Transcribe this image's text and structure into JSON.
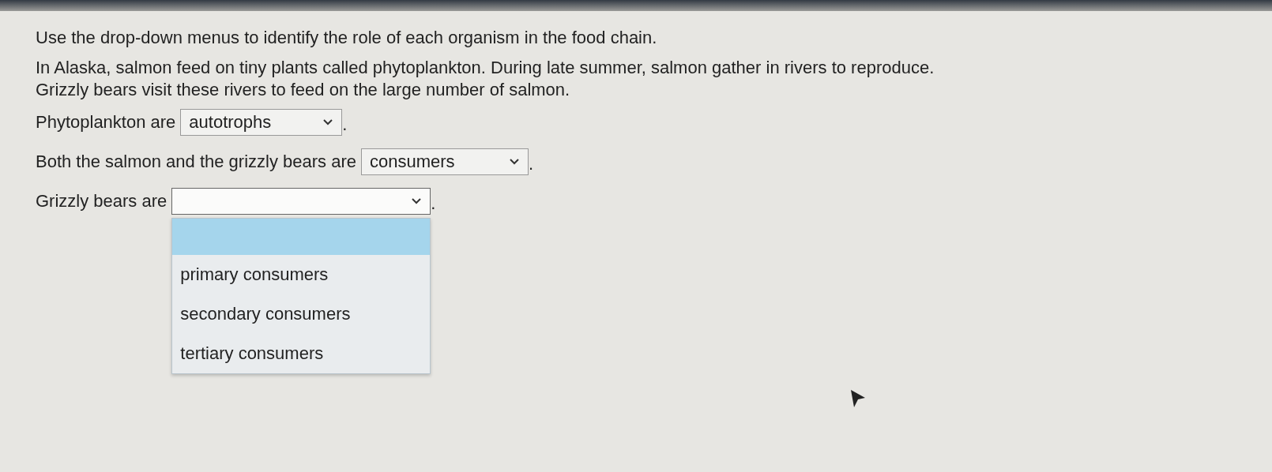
{
  "instructions": "Use the drop-down menus to identify the role of each organism in the food chain.",
  "passage_lines": [
    "In Alaska, salmon feed on tiny plants called phytoplankton. During late summer, salmon gather in rivers to reproduce.",
    "Grizzly bears visit these rivers to feed on the large number of salmon."
  ],
  "questions": [
    {
      "prompt": "Phytoplankton are",
      "value": "autotrophs",
      "suffix": ".",
      "open": false
    },
    {
      "prompt": "Both the salmon and the grizzly bears are",
      "value": "consumers",
      "suffix": ".",
      "open": false
    },
    {
      "prompt": "Grizzly bears are",
      "suffix": ".",
      "open": true,
      "blank_highlighted": true,
      "options": [
        {
          "label": "primary consumers",
          "selected": false
        },
        {
          "label": "secondary consumers",
          "selected": false
        },
        {
          "label": "tertiary consumers",
          "selected": false
        }
      ]
    }
  ]
}
